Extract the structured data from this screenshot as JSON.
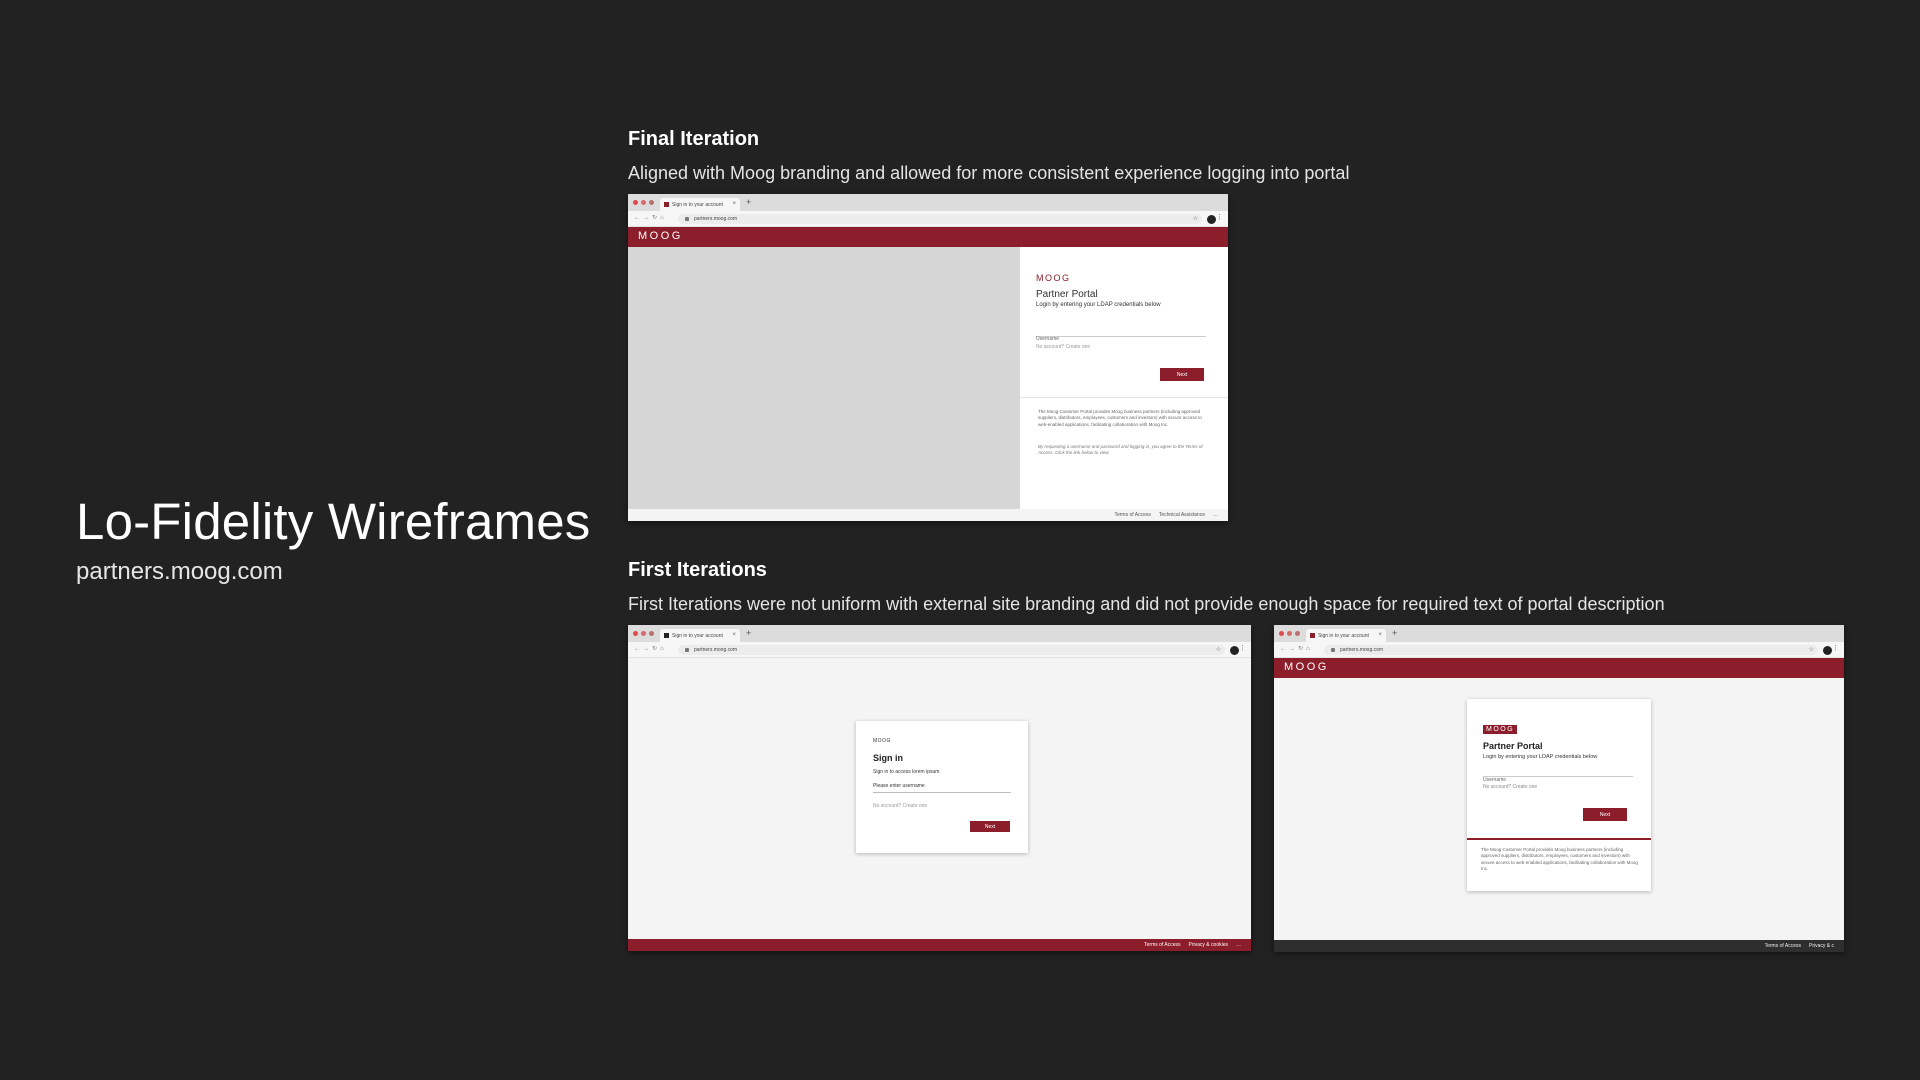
{
  "page": {
    "title": "Lo-Fidelity Wireframes",
    "subtitle": "partners.moog.com"
  },
  "final": {
    "heading": "Final Iteration",
    "description": "Aligned with Moog branding and allowed for more consistent experience logging into portal",
    "browser": {
      "tab_label": "Sign in to your account",
      "url": "partners.moog.com",
      "brand": "MOOG",
      "card_logo": "MOOG",
      "card_title": "Partner Portal",
      "card_subtitle": "Login by entering your LDAP credentials below",
      "username_placeholder": "Username",
      "no_account": "No account? Create one",
      "next_label": "Next",
      "info_text": "The Moog Customer Portal provides Moog business partners (including approved suppliers, distributors, employees, customers and investors) with secure access to web-enabled applications, facilitating collaboration with Moog Inc.",
      "agree_text": "By requesting a username and password and logging in, you agree to the Terms of Access. Click the link below to view.",
      "footer_links": [
        "Terms of Access",
        "Technical Assistance"
      ]
    }
  },
  "first": {
    "heading": "First Iterations",
    "description": "First Iterations were not uniform with external site branding and did not provide enough space for required text of portal description",
    "browser_a": {
      "tab_label": "Sign in to your account",
      "url": "partners.moog.com",
      "card_logo": "MOOG",
      "card_title": "Sign in",
      "card_subtitle": "Sign in to access lorem ipsum",
      "username_value": "Please enter username",
      "no_account": "No account? Create one",
      "next_label": "Next",
      "footer_links": [
        "Terms of Access",
        "Privacy & cookies"
      ]
    },
    "browser_b": {
      "tab_label": "Sign in to your account",
      "url": "partners.moog.com",
      "brand": "MOOG",
      "card_logo": "MOOG",
      "card_title": "Partner Portal",
      "card_subtitle": "Login by entering your LDAP credentials below",
      "username_placeholder": "Username",
      "no_account": "No account? Create one",
      "next_label": "Next",
      "info_text": "The Moog Customer Portal provides Moog business partners (including approved suppliers, distributors, employees, customers and investors) with secure access to web-enabled applications, facilitating collaboration with Moog Inc.",
      "footer_links": [
        "Terms of Access",
        "Privacy & c"
      ]
    }
  },
  "colors": {
    "background": "#222222",
    "brand": "#8c1d2a",
    "placeholder_panel": "#d6d6d6"
  },
  "icons": [
    "back-arrow-icon",
    "forward-arrow-icon",
    "reload-icon",
    "home-icon",
    "lock-icon",
    "star-icon",
    "profile-icon",
    "kebab-menu-icon",
    "tab-close-icon",
    "new-tab-icon"
  ]
}
